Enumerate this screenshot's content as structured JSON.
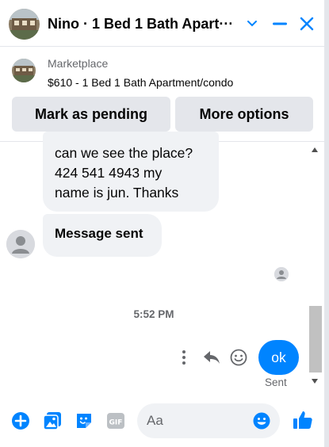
{
  "header": {
    "title": "Nino · 1 Bed 1 Bath Apart···",
    "avatar_icon": "house-photo-avatar",
    "minimize_icon": "chevron-down-icon",
    "collapse_icon": "minus-icon",
    "close_icon": "close-icon"
  },
  "marketplace": {
    "label": "Marketplace",
    "item": "$610 - 1 Bed 1 Bath Apartment/condo",
    "mark_pending_label": "Mark as pending",
    "more_options_label": "More options"
  },
  "messages": {
    "previous_lines": [
      "can we see the  place?",
      "424 541 4943 my",
      "name is jun. Thanks"
    ],
    "status_message": "Message sent",
    "timestamp": "5:52 PM",
    "my_message": "ok",
    "sent_label": "Sent"
  },
  "composer": {
    "placeholder": "Aa"
  },
  "colors": {
    "accent": "#0084ff",
    "bubble_bg": "#f0f2f5",
    "button_bg": "#e4e6eb",
    "secondary_text": "#65676b"
  }
}
